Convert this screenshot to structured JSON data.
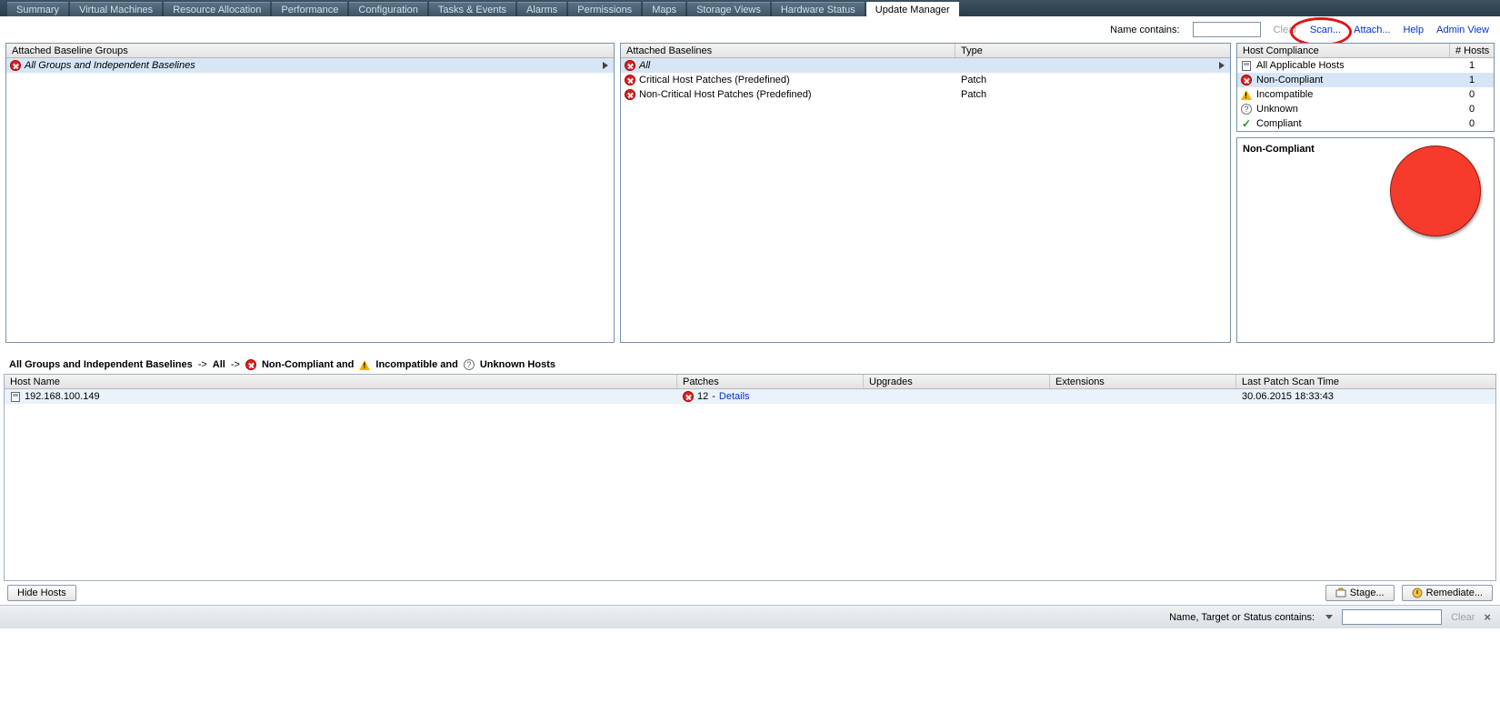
{
  "tabs": [
    {
      "label": "Summary"
    },
    {
      "label": "Virtual Machines"
    },
    {
      "label": "Resource Allocation"
    },
    {
      "label": "Performance"
    },
    {
      "label": "Configuration"
    },
    {
      "label": "Tasks & Events"
    },
    {
      "label": "Alarms"
    },
    {
      "label": "Permissions"
    },
    {
      "label": "Maps"
    },
    {
      "label": "Storage Views"
    },
    {
      "label": "Hardware Status"
    },
    {
      "label": "Update Manager",
      "active": true
    }
  ],
  "toolbar": {
    "filter_label": "Name contains:",
    "filter_value": "",
    "clear": "Clear",
    "scan": "Scan...",
    "attach": "Attach...",
    "help": "Help",
    "admin": "Admin View"
  },
  "baseline_groups": {
    "header": "Attached Baseline Groups",
    "rows": [
      {
        "label": "All Groups and Independent Baselines",
        "italic": true,
        "selected": true,
        "icon": "err",
        "arrow": true
      }
    ]
  },
  "baselines": {
    "headers": {
      "name": "Attached Baselines",
      "type": "Type"
    },
    "rows": [
      {
        "name": "All",
        "italic": true,
        "selected": true,
        "icon": "err",
        "arrow": true,
        "type": ""
      },
      {
        "name": "Critical Host Patches (Predefined)",
        "icon": "err",
        "type": "Patch"
      },
      {
        "name": "Non-Critical Host Patches (Predefined)",
        "icon": "err",
        "type": "Patch"
      }
    ]
  },
  "compliance": {
    "headers": {
      "name": "Host Compliance",
      "count": "# Hosts"
    },
    "rows": [
      {
        "icon": "host",
        "label": "All Applicable Hosts",
        "count": 1
      },
      {
        "icon": "err",
        "label": "Non-Compliant",
        "count": 1,
        "selected": true
      },
      {
        "icon": "warn",
        "label": "Incompatible",
        "count": 0
      },
      {
        "icon": "q",
        "label": "Unknown",
        "count": 0
      },
      {
        "icon": "ok",
        "label": "Compliant",
        "count": 0
      }
    ],
    "chart_title": "Non-Compliant"
  },
  "chart_data": {
    "type": "pie",
    "title": "Non-Compliant",
    "series": [
      {
        "name": "Non-Compliant",
        "value": 1,
        "color": "#f63a2b"
      }
    ],
    "total": 1
  },
  "breadcrumb": {
    "a": "All Groups and Independent Baselines",
    "b": "All",
    "c": "Non-Compliant and",
    "d": "Incompatible and",
    "e": "Unknown Hosts"
  },
  "hosts": {
    "headers": {
      "name": "Host Name",
      "patches": "Patches",
      "upgrades": "Upgrades",
      "extensions": "Extensions",
      "scan": "Last Patch Scan Time"
    },
    "rows": [
      {
        "name": "192.168.100.149",
        "patches_count": "12",
        "patches_link": "Details",
        "scan": "30.06.2015 18:33:43"
      }
    ]
  },
  "buttons": {
    "hide": "Hide Hosts",
    "stage": "Stage...",
    "remediate": "Remediate..."
  },
  "bottom_filter": {
    "label": "Name, Target or Status contains:",
    "value": "",
    "clear": "Clear"
  }
}
